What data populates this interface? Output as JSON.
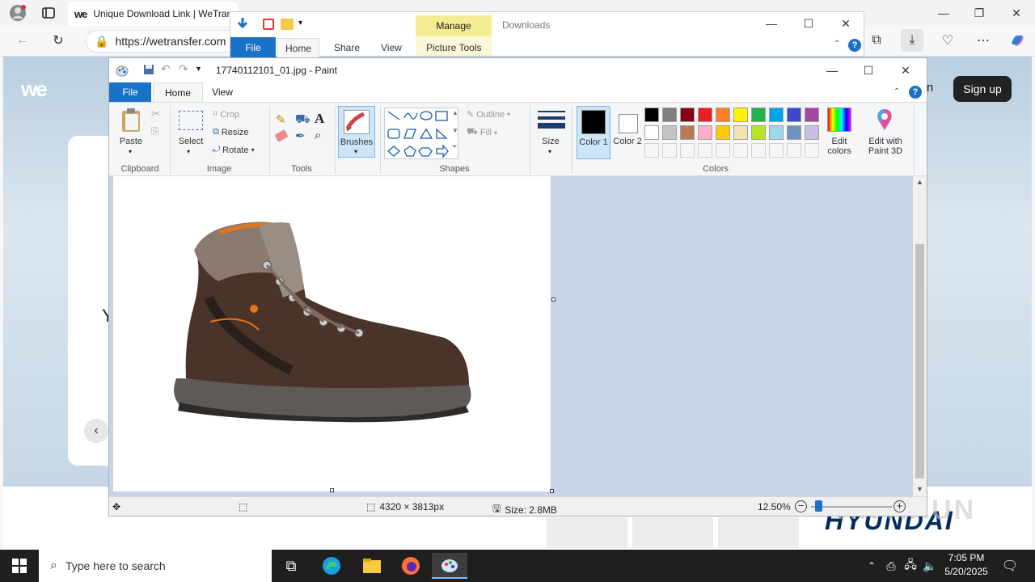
{
  "browser": {
    "tab_title": "Unique Download Link | WeTrans",
    "tab_favicon": "we",
    "url": "https://wetransfer.com",
    "page": {
      "logo": "we",
      "signup_label": "Sign up",
      "signin_fragment": "n",
      "hidden_text": "Y"
    }
  },
  "explorer": {
    "manage_label": "Manage",
    "title": "Downloads",
    "tabs": [
      "File",
      "Home",
      "Share",
      "View",
      "Picture Tools"
    ]
  },
  "paint": {
    "title": "17740112101_01.jpg - Paint",
    "tabs": {
      "file": "File",
      "home": "Home",
      "view": "View"
    },
    "clipboard": {
      "paste": "Paste",
      "label": "Clipboard"
    },
    "image": {
      "select": "Select",
      "crop": "Crop",
      "resize": "Resize",
      "rotate": "Rotate",
      "label": "Image"
    },
    "tools": {
      "label": "Tools"
    },
    "brushes": {
      "label": "Brushes"
    },
    "shapes": {
      "outline": "Outline",
      "fill": "Fill",
      "label": "Shapes"
    },
    "size": {
      "label": "Size"
    },
    "colors": {
      "color1": "Color 1",
      "color2": "Color 2",
      "edit_colors": "Edit colors",
      "edit_paint3d": "Edit with Paint 3D",
      "label": "Colors",
      "row1": [
        "#000000",
        "#7f7f7f",
        "#880015",
        "#ed1c24",
        "#ff7f27",
        "#fff200",
        "#22b14c",
        "#00a2e8",
        "#3f48cc",
        "#a349a4"
      ],
      "row2": [
        "#ffffff",
        "#c3c3c3",
        "#b97a57",
        "#ffaec9",
        "#ffc90e",
        "#efe4b0",
        "#b5e61d",
        "#99d9ea",
        "#7092be",
        "#c8bfe7"
      ]
    },
    "status": {
      "dimensions": "4320 × 3813px",
      "size": "Size: 2.8MB",
      "zoom": "12.50%"
    }
  },
  "taskbar": {
    "search_placeholder": "Type here to search",
    "time": "7:05 PM",
    "date": "5/20/2025"
  },
  "background": {
    "brand_logo": "HYUNDAI",
    "watermark": "ANY.RUN"
  }
}
